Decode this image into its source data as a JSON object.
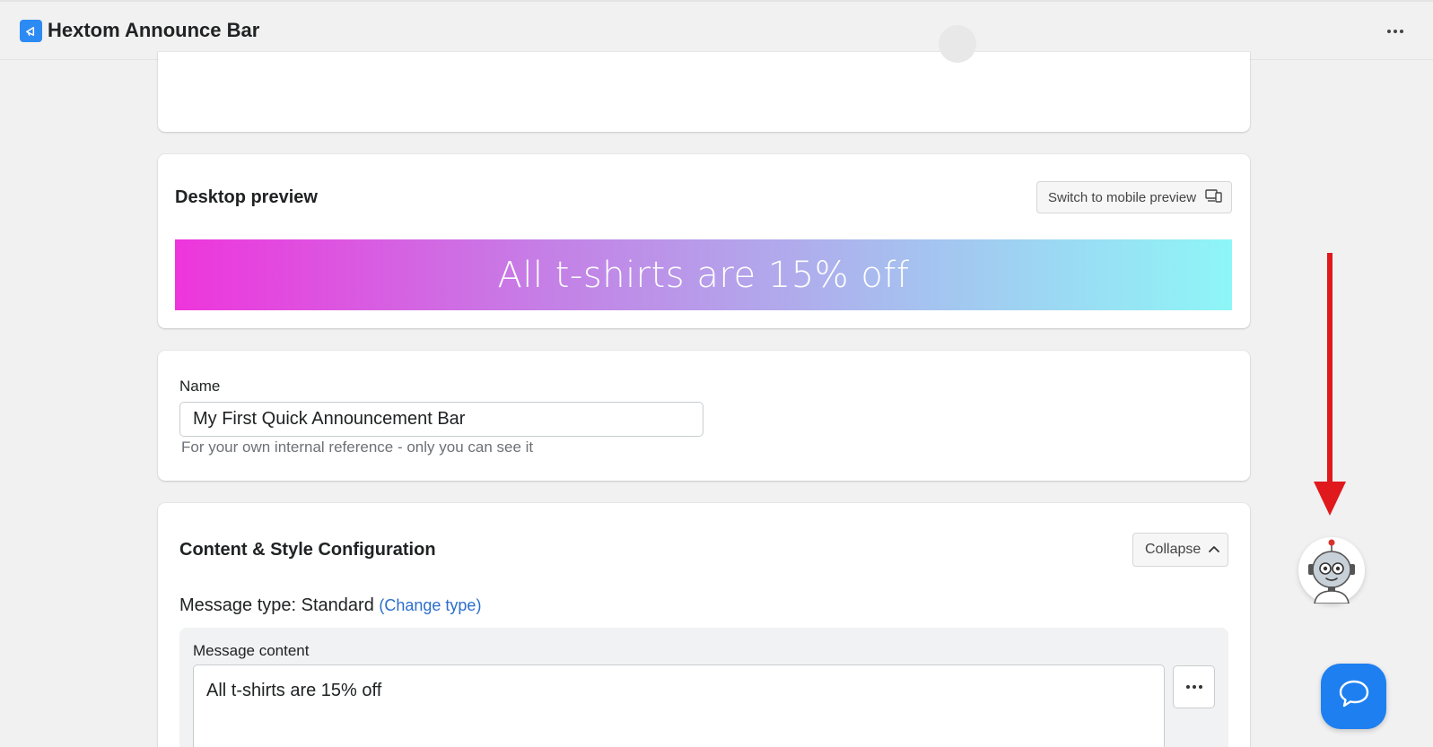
{
  "app": {
    "title": "Hextom Announce Bar",
    "icon": "hextom-logo-icon",
    "accent_color": "#2c8af3"
  },
  "preview": {
    "title": "Desktop preview",
    "switch_label": "Switch to mobile preview",
    "banner_text": "All t-shirts are 15% off",
    "banner_gradient": [
      "#ee35dc",
      "#8ef6f7"
    ]
  },
  "name_section": {
    "label": "Name",
    "value": "My First Quick Announcement Bar",
    "help": "For your own internal reference - only you can see it"
  },
  "config": {
    "title": "Content & Style Configuration",
    "collapse_label": "Collapse",
    "message_type_label": "Message type:",
    "message_type_value": "Standard",
    "change_type_label": "(Change type)",
    "content_label": "Message content",
    "content_value": "All t-shirts are 15% off"
  },
  "colors": {
    "link": "#2c6ecb",
    "annotation_arrow": "#e0191c",
    "chat_button": "#1d7ff0"
  }
}
